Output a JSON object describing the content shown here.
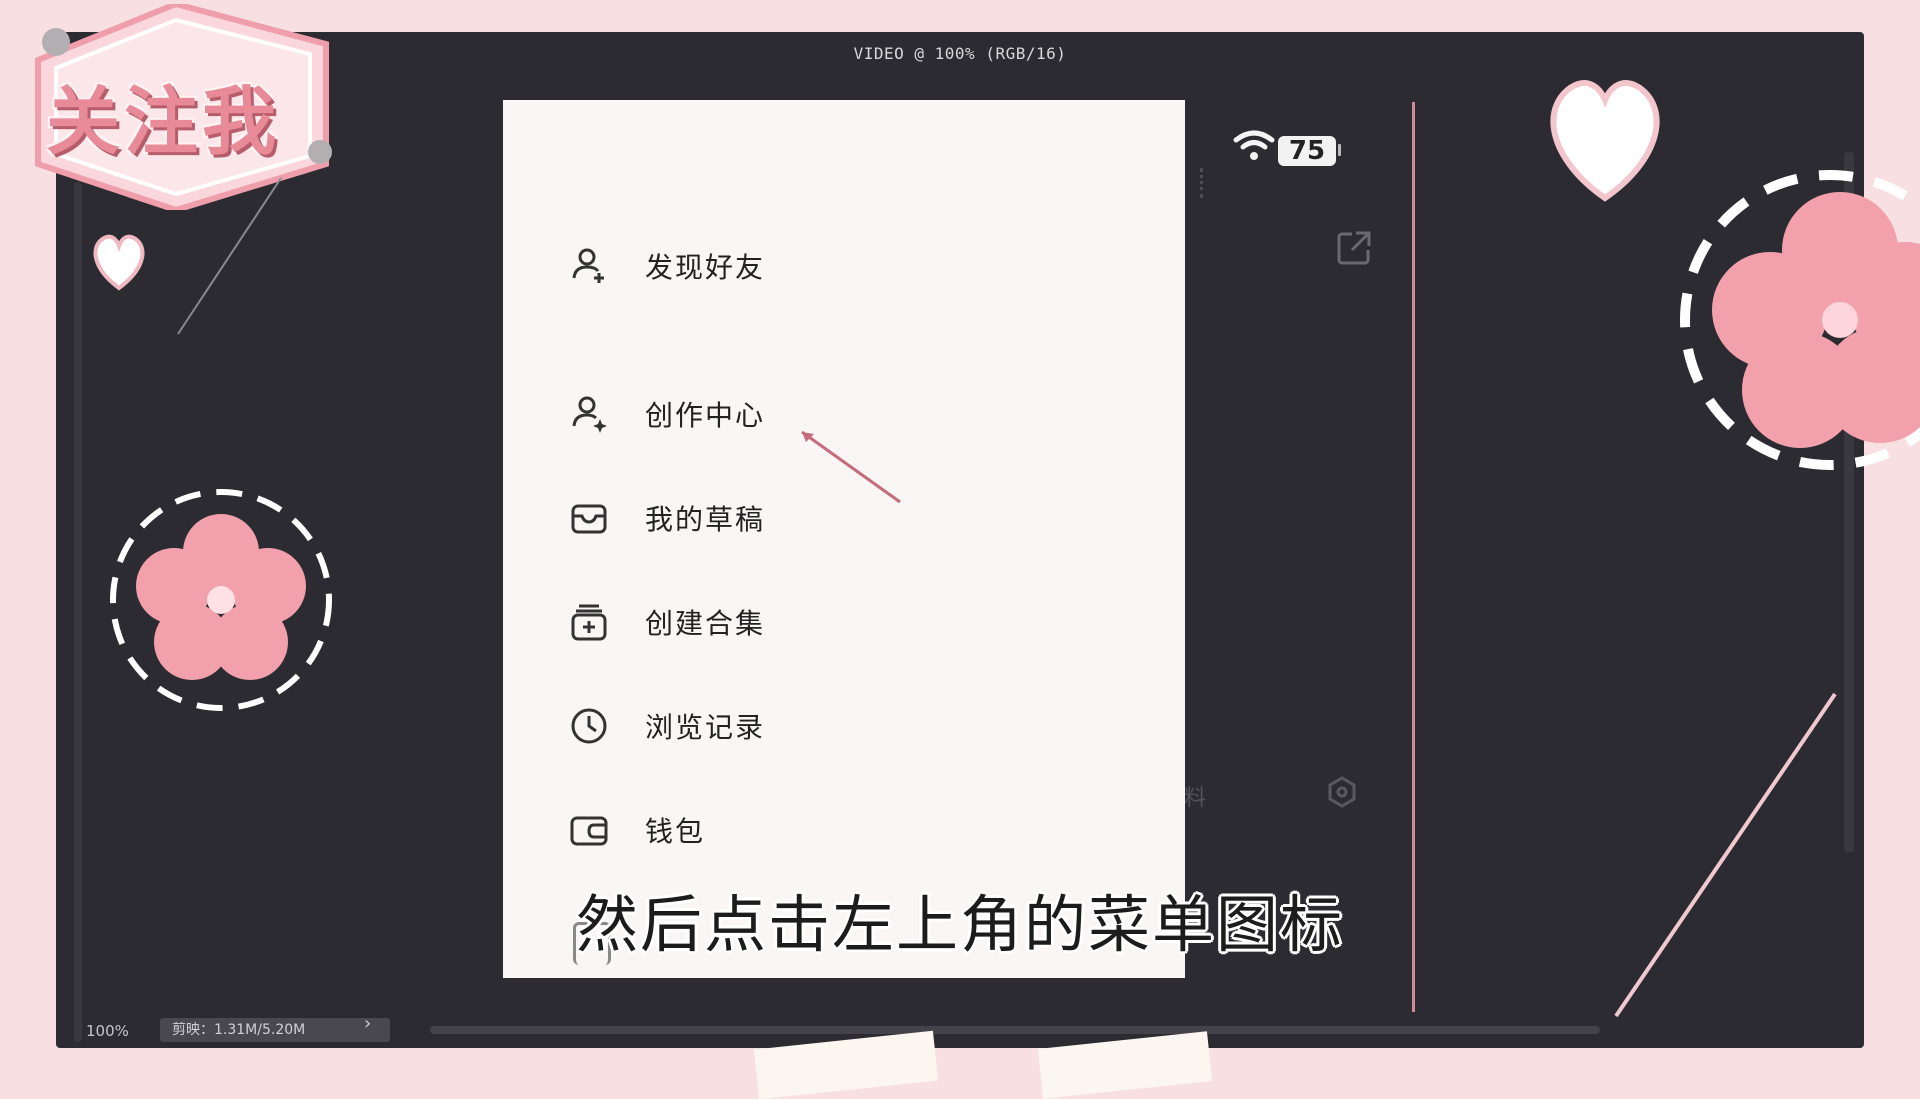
{
  "app_title": "VIDEO @ 100% (RGB/16)",
  "status": {
    "battery": "75"
  },
  "menu": {
    "items": [
      {
        "label": "发现好友",
        "icon": "add-friend-icon"
      },
      {
        "label": "创作中心",
        "icon": "creator-icon"
      },
      {
        "label": "我的草稿",
        "icon": "drafts-inbox-icon"
      },
      {
        "label": "创建合集",
        "icon": "create-collection-icon"
      },
      {
        "label": "浏览记录",
        "icon": "history-clock-icon"
      },
      {
        "label": "钱包",
        "icon": "wallet-icon"
      }
    ]
  },
  "bottom_bar": {
    "zoom": "100%",
    "clip_info": "剪映：1.31M/5.20M"
  },
  "subtitle": "然后点击左上角的菜单图标",
  "badge": {
    "text": "关注我"
  },
  "colors": {
    "accent_pink": "#f2a0ac",
    "dark_bg": "#2c2b31",
    "panel": "#faf6f6"
  }
}
